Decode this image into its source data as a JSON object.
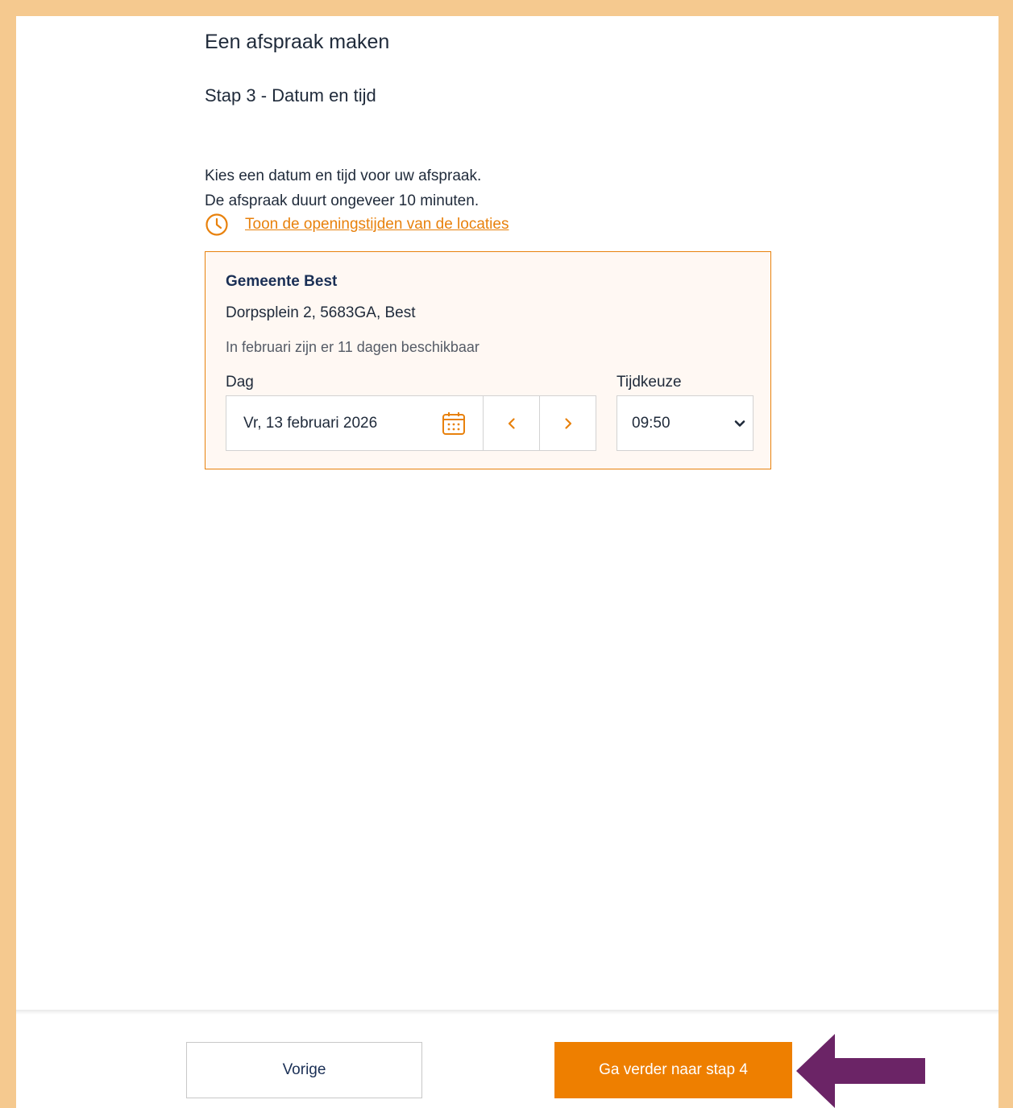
{
  "header": {
    "title": "Een afspraak maken",
    "step": "Stap 3 - Datum en tijd"
  },
  "intro": {
    "line1": "Kies een datum en tijd voor uw afspraak.",
    "line2": "De afspraak duurt ongeveer 10 minuten."
  },
  "opening_hours_link": "Toon de openingstijden van de locaties",
  "location": {
    "name": "Gemeente Best",
    "address": "Dorpsplein 2, 5683GA, Best",
    "availability": "In februari zijn er 11 dagen beschikbaar",
    "day_label": "Dag",
    "day_value": "Vr, 13 februari 2026",
    "time_label": "Tijdkeuze",
    "time_value": "09:50"
  },
  "footer": {
    "prev_label": "Vorige",
    "next_label": "Ga verder naar stap 4"
  },
  "colors": {
    "accent": "#ee7f00",
    "frame": "#f5c98f",
    "arrow": "#6b2466",
    "heading": "#1a2f55"
  },
  "icons": [
    "clock-icon",
    "calendar-icon",
    "chevron-left-icon",
    "chevron-right-icon",
    "chevron-down-icon",
    "arrow-left-icon"
  ]
}
